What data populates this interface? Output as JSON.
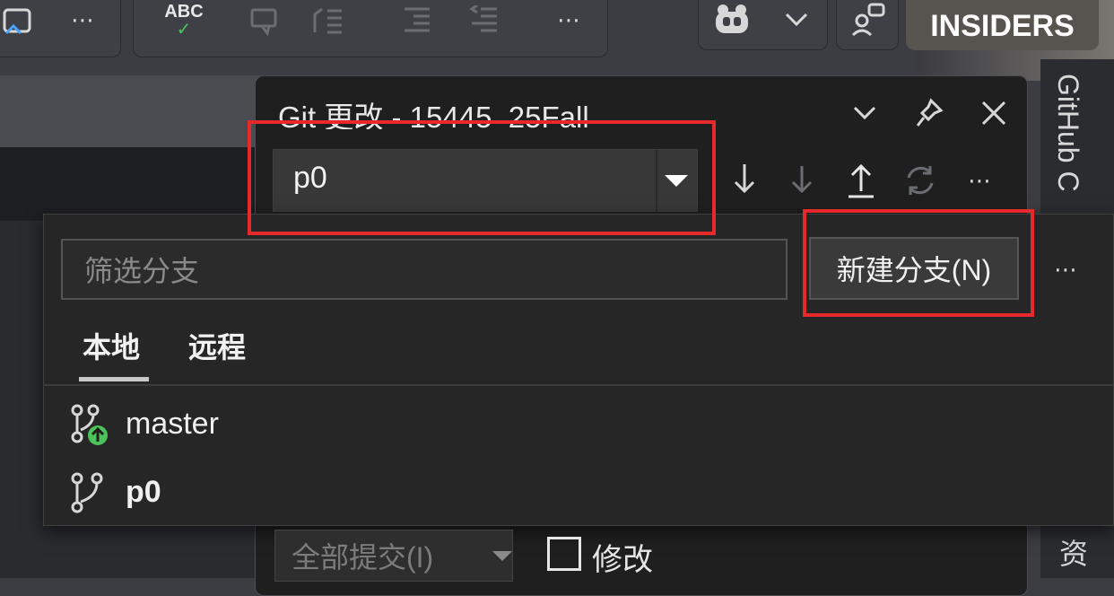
{
  "toolbar": {
    "overflow": "⋯",
    "spell_label": "ABC",
    "spell_check": "✓",
    "insiders_label": "INSIDERS"
  },
  "git_panel": {
    "title": "Git 更改 - 15445_25Fall",
    "current_branch": "p0",
    "more": "⋯"
  },
  "branch_dropdown": {
    "filter_placeholder": "筛选分支",
    "new_branch_label": "新建分支(N)",
    "more": "⋯",
    "tabs": [
      {
        "label": "本地"
      },
      {
        "label": "远程"
      }
    ],
    "branches": [
      {
        "name": "master"
      },
      {
        "name": "p0"
      }
    ]
  },
  "commit_bar": {
    "commit_all_label": "全部提交(I)",
    "amend_label": "修改"
  },
  "right_rail": {
    "github_label": "GitHub C",
    "bottom_label": "资"
  },
  "colors": {
    "highlight_red": "#e8292c",
    "push_green": "#4cc35a"
  }
}
